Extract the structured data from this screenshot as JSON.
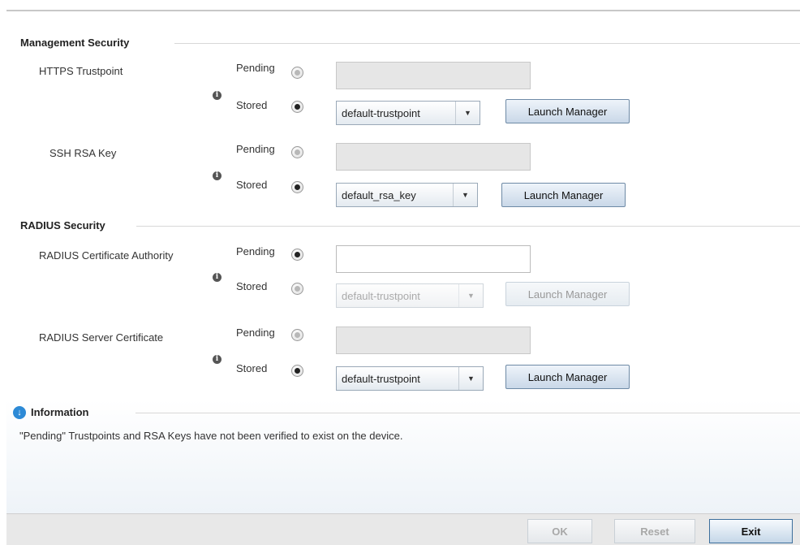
{
  "management_security": {
    "title": "Management Security",
    "https_trustpoint": {
      "label": "HTTPS Trustpoint",
      "pending_label": "Pending",
      "stored_label": "Stored",
      "pending_value": "",
      "selected": "stored",
      "stored_value": "default-trustpoint",
      "launch_label": "Launch Manager"
    },
    "ssh_rsa_key": {
      "label": "SSH RSA Key",
      "pending_label": "Pending",
      "stored_label": "Stored",
      "pending_value": "",
      "selected": "stored",
      "stored_value": "default_rsa_key",
      "launch_label": "Launch Manager"
    }
  },
  "radius_security": {
    "title": "RADIUS Security",
    "certificate_authority": {
      "label": "RADIUS Certificate Authority",
      "pending_label": "Pending",
      "stored_label": "Stored",
      "pending_value": "",
      "selected": "pending",
      "stored_value": "default-trustpoint",
      "launch_label": "Launch Manager"
    },
    "server_certificate": {
      "label": "RADIUS Server Certificate",
      "pending_label": "Pending",
      "stored_label": "Stored",
      "pending_value": "",
      "selected": "stored",
      "stored_value": "default-trustpoint",
      "launch_label": "Launch Manager"
    }
  },
  "information": {
    "title": "Information",
    "message": "\"Pending\" Trustpoints and RSA Keys have not been verified to exist on the device."
  },
  "footer": {
    "ok_label": "OK",
    "reset_label": "Reset",
    "exit_label": "Exit"
  },
  "colors": {
    "info_icon": "#2d8ad6",
    "button_border": "#6e8aa6",
    "footer_bg": "#e8e8e8"
  },
  "icons": {
    "info_dot": "info-icon",
    "radio": "radio-icon",
    "dropdown": "chevron-down-icon",
    "expand": "arrow-down-circle-icon"
  }
}
